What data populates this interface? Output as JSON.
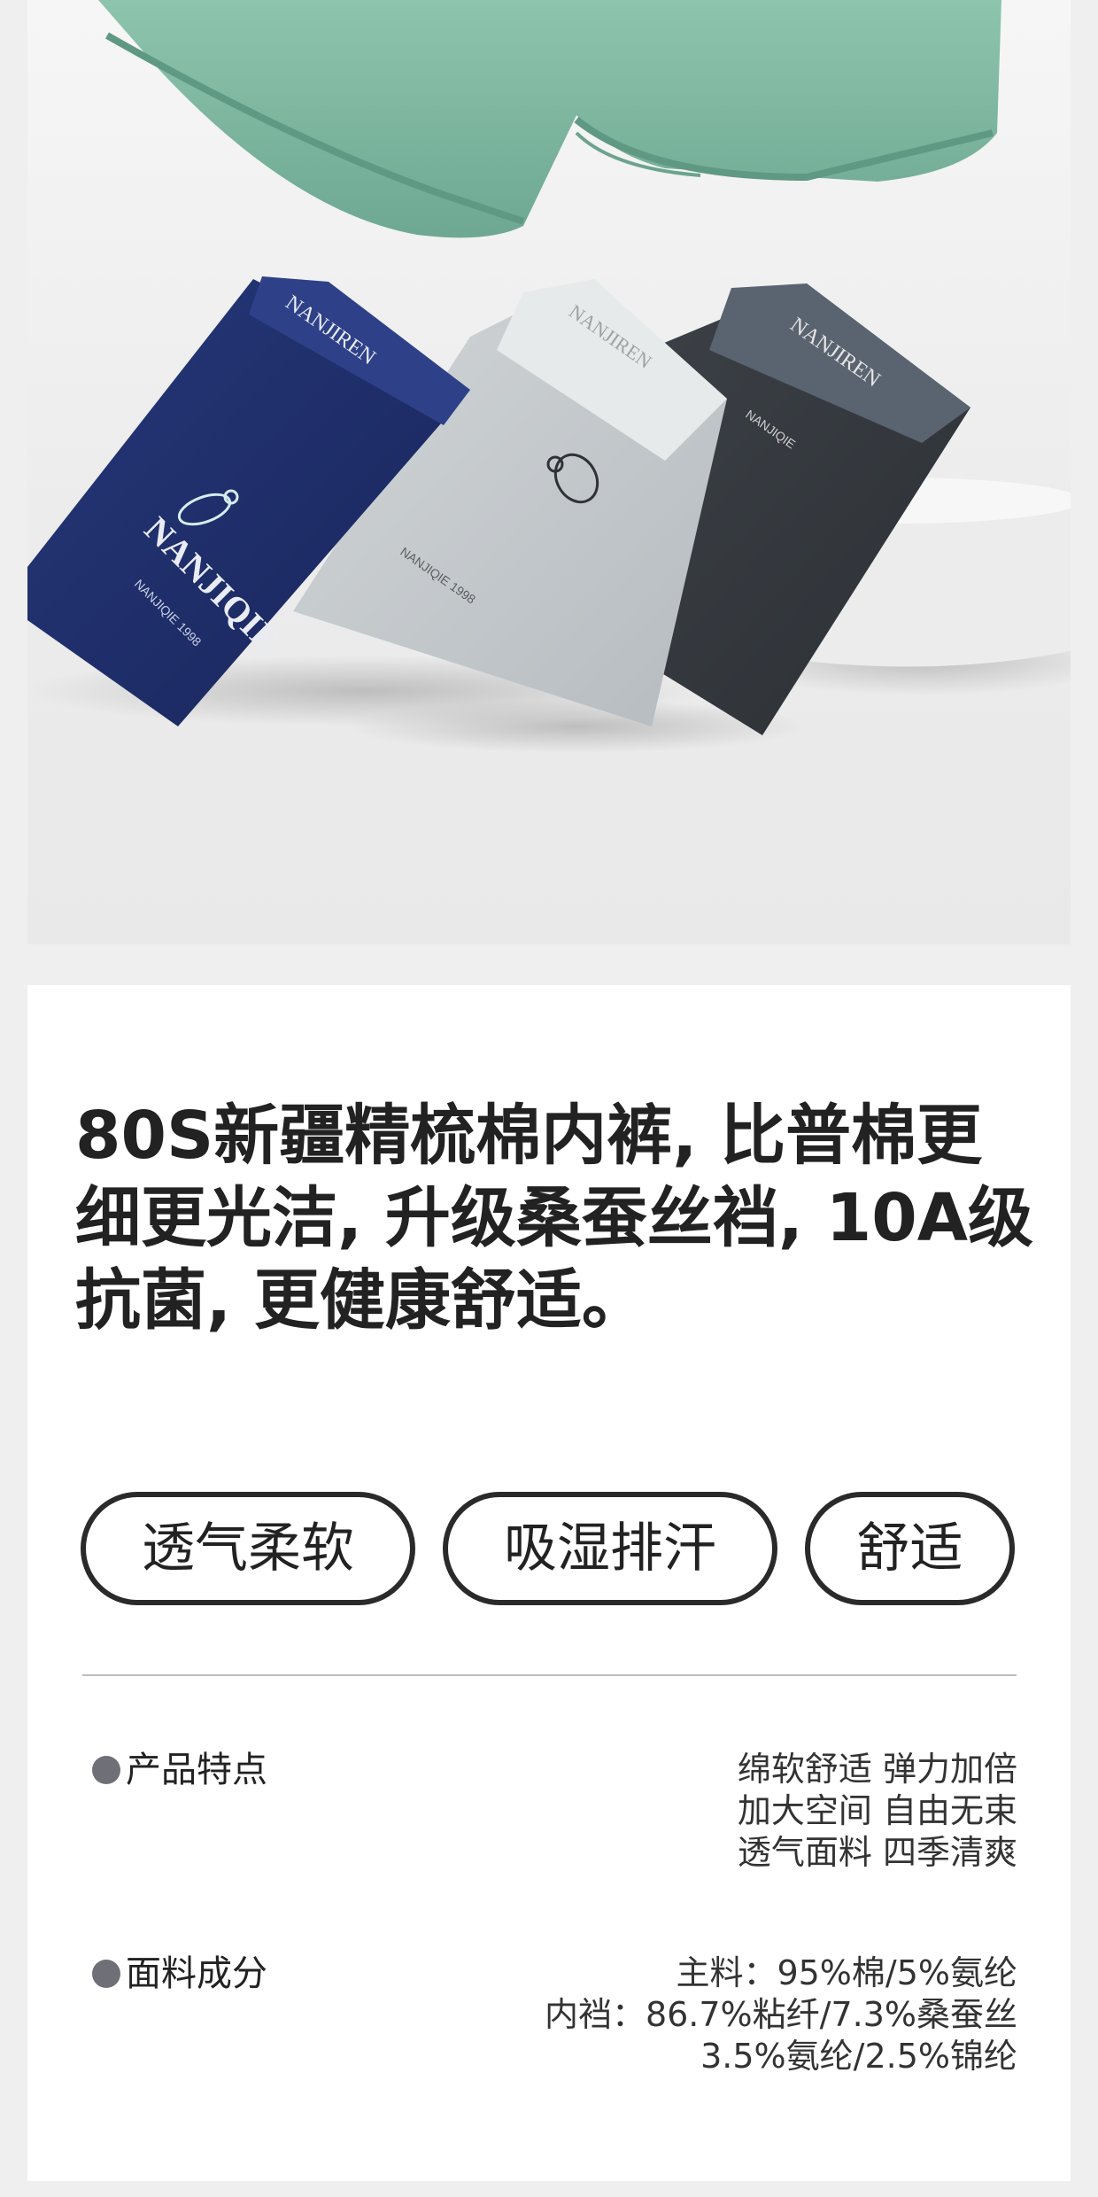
{
  "hero": {
    "brand_marks": [
      "NANJIREN",
      "NANJIQIE",
      "NANJIQIE 1998"
    ]
  },
  "headline": [
    "80S新疆精梳棉内裤, 比普棉更",
    "细更光洁, 升级桑蚕丝裆, 10A级",
    "抗菌, 更健康舒适。"
  ],
  "tags": [
    "透气柔软",
    "吸湿排汗",
    "舒适"
  ],
  "specs": [
    {
      "label": "产品特点",
      "values": [
        "绵软舒适 弹力加倍",
        "加大空间 自由无束",
        "透气面料 四季清爽"
      ]
    },
    {
      "label": "面料成分",
      "values": [
        "主料：95%棉/5%氨纶",
        "内裆：86.7%粘纤/7.3%桑蚕丝",
        "3.5%氨纶/2.5%锦纶"
      ]
    }
  ],
  "colors": {
    "green": "#7fb9a2",
    "navy": "#1f2f66",
    "grey": "#c4c9cc",
    "charcoal": "#34383d",
    "tag_border": "#2a2a2a",
    "bullet": "#6f6f78"
  }
}
